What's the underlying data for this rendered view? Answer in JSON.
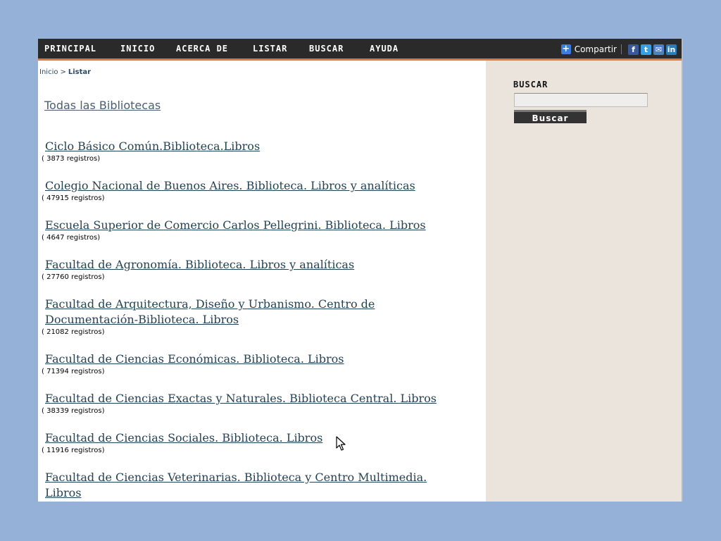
{
  "nav": {
    "items": [
      "PRINCIPAL",
      "INICIO",
      "ACERCA DE",
      "LISTAR",
      "BUSCAR",
      "AYUDA"
    ],
    "share_label": "Compartir",
    "share_icons": [
      "plus-icon",
      "facebook-icon",
      "twitter-icon",
      "email-icon",
      "linkedin-icon"
    ],
    "accent_color": "#e07a35"
  },
  "breadcrumb": {
    "home": "Inicio",
    "separator": ">",
    "current": "Listar"
  },
  "all_libraries": "Todas las Bibliotecas",
  "libraries": [
    {
      "name": "Ciclo Básico Común.Biblioteca.Libros",
      "count": "( 3873 registros)"
    },
    {
      "name": "Colegio Nacional de Buenos Aires. Biblioteca. Libros y analíticas",
      "count": "( 47915 registros)"
    },
    {
      "name": "Escuela Superior de Comercio Carlos Pellegrini. Biblioteca. Libros",
      "count": "( 4647 registros)"
    },
    {
      "name": "Facultad de Agronomía. Biblioteca. Libros y analíticas",
      "count": "( 27760 registros)"
    },
    {
      "name": "Facultad de Arquitectura, Diseño y Urbanismo. Centro de Documentación-Biblioteca. Libros",
      "count": "( 21082 registros)"
    },
    {
      "name": "Facultad de Ciencias Económicas. Biblioteca. Libros",
      "count": "( 71394 registros)"
    },
    {
      "name": "Facultad de Ciencias Exactas y Naturales. Biblioteca Central. Libros",
      "count": "( 38339 registros)"
    },
    {
      "name": "Facultad de Ciencias Sociales. Biblioteca. Libros",
      "count": "( 11916 registros)"
    },
    {
      "name": "Facultad de Ciencias Veterinarias. Biblioteca y Centro Multimedia. Libros",
      "count": ""
    }
  ],
  "sidebar": {
    "heading": "BUSCAR",
    "input_value": "",
    "button_label": "Buscar"
  }
}
